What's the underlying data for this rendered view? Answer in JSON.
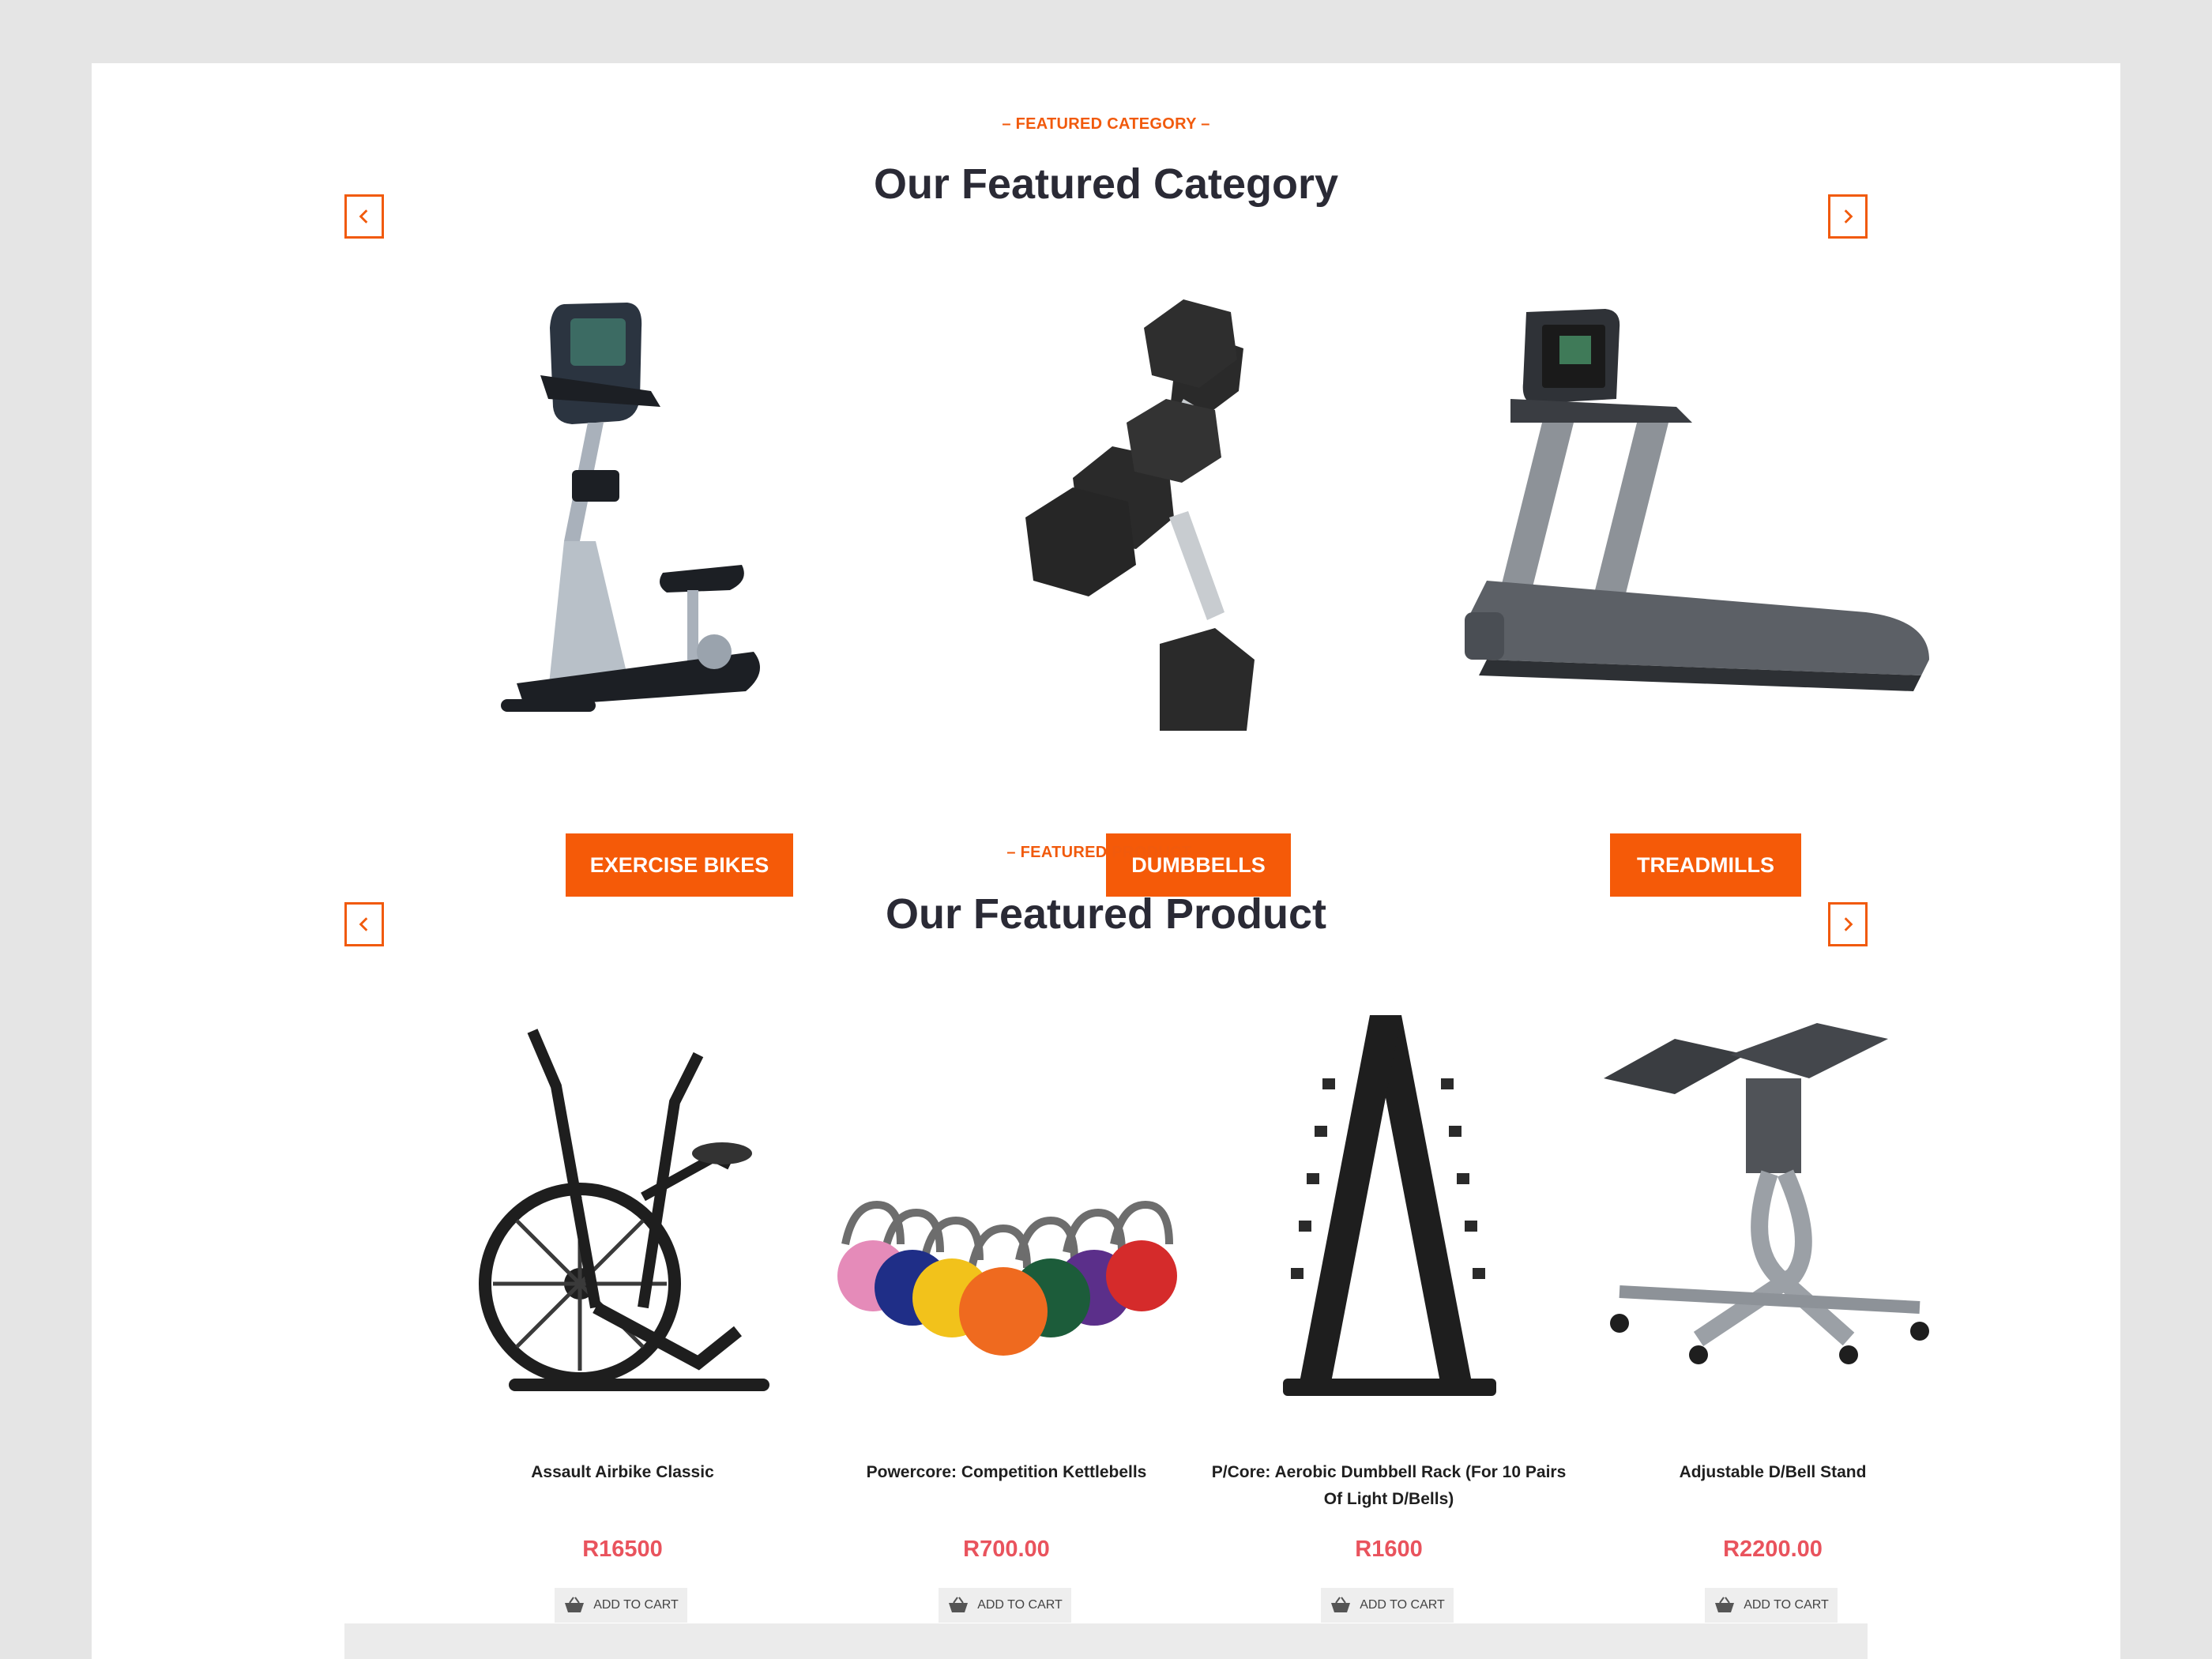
{
  "featured_category": {
    "eyebrow": "– FEATURED CATEGORY –",
    "title": "Our Featured Category",
    "items": [
      {
        "label": "EXERCISE BIKES"
      },
      {
        "label": "DUMBBELLS"
      },
      {
        "label": "TREADMILLS"
      }
    ]
  },
  "featured_product": {
    "eyebrow": "– FEATURED PRODUCT –",
    "title": "Our Featured Product",
    "items": [
      {
        "name": "Assault Airbike Classic",
        "price": "R16500",
        "cart_label": "ADD TO CART"
      },
      {
        "name": "Powercore: Competition Kettlebells",
        "price": "R700.00",
        "cart_label": "ADD TO CART"
      },
      {
        "name": "P/Core: Aerobic Dumbbell Rack (For 10 Pairs Of Light D/Bells)",
        "price": "R1600",
        "cart_label": "ADD TO CART"
      },
      {
        "name": "Adjustable D/Bell Stand",
        "price": "R2200.00",
        "cart_label": "ADD TO CART"
      }
    ]
  },
  "colors": {
    "accent": "#f15a0c",
    "price": "#e9535d",
    "title": "#2a2a35"
  },
  "icons": [
    "chevron-left-icon",
    "chevron-right-icon",
    "basket-icon"
  ]
}
